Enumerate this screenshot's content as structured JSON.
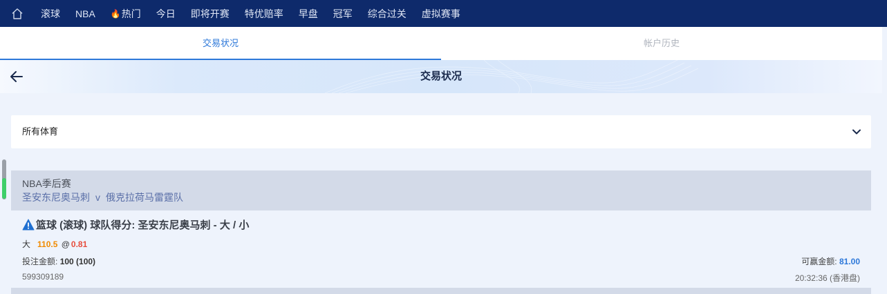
{
  "nav": {
    "items": [
      "滚球",
      "NBA",
      "热门",
      "今日",
      "即将开赛",
      "特优赔率",
      "早盘",
      "冠军",
      "综合过关",
      "虚拟赛事"
    ]
  },
  "tabs": [
    {
      "label": "交易状况",
      "active": true
    },
    {
      "label": "帐户历史",
      "active": false
    }
  ],
  "header": {
    "title": "交易状况"
  },
  "filter": {
    "selected": "所有体育"
  },
  "league": {
    "name": "NBA季后赛",
    "home": "圣安东尼奥马刺",
    "vs": "v",
    "away": "俄克拉荷马雷霆队"
  },
  "bet": {
    "title": "篮球 (滚球) 球队得分: 圣安东尼奥马刺 - 大 / 小",
    "selection": "大",
    "handicap": "110.5",
    "at": "@",
    "odds": "0.81",
    "stake_label": "投注金额:",
    "stake_value": "100 (100)",
    "win_label": "可赢金额:",
    "win_value": "81.00",
    "ticket_id": "599309189",
    "time": "20:32:36 (香港盘)"
  },
  "colors": {
    "nav_bg": "#0e2a6b",
    "accent": "#2d78d9",
    "handicap": "#f08a00",
    "odds": "#e74c3c",
    "scroll_thumb": "#3ecf6a"
  }
}
